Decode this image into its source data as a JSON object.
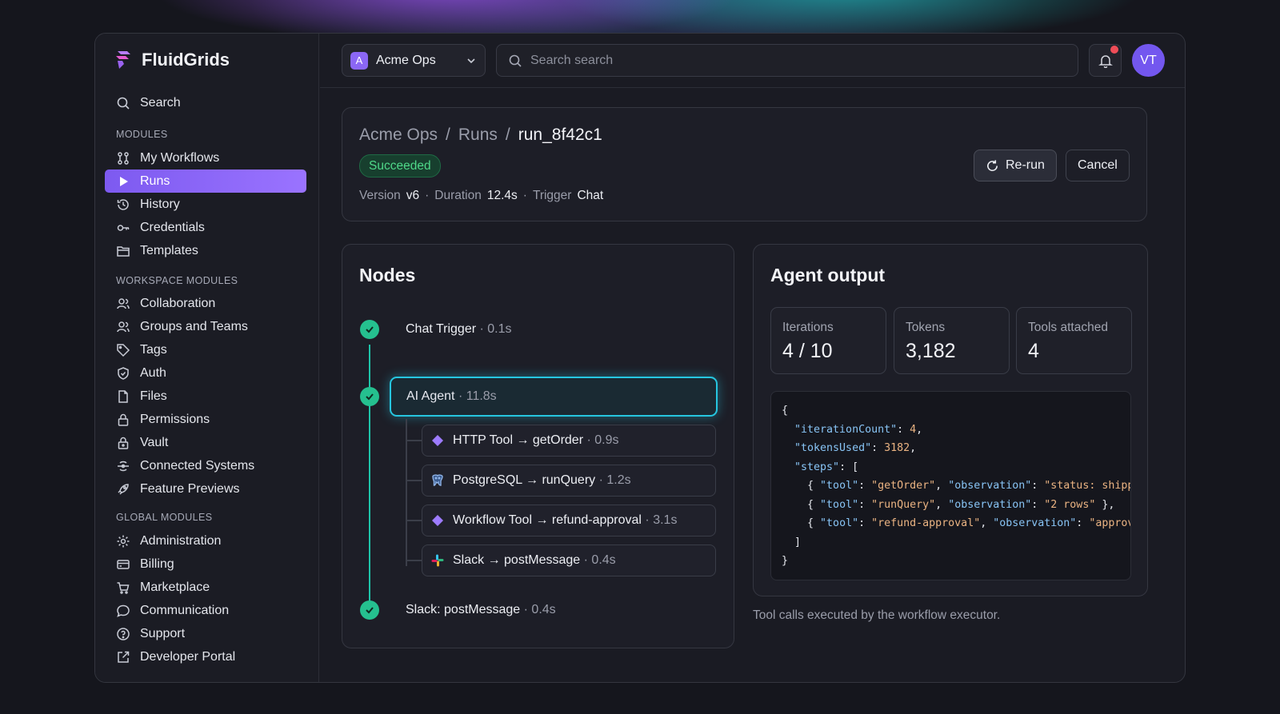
{
  "brand": {
    "name": "FluidGrids"
  },
  "sidebar": {
    "search_label": "Search",
    "sections": [
      {
        "label": "MODULES"
      },
      {
        "label": "WORKSPACE MODULES"
      },
      {
        "label": "GLOBAL MODULES"
      }
    ],
    "modules": [
      "My Workflows",
      "Runs",
      "History",
      "Credentials",
      "Templates"
    ],
    "active_item": "Runs",
    "workspace_modules": [
      "Collaboration",
      "Groups and Teams",
      "Tags",
      "Auth",
      "Files",
      "Permissions",
      "Vault",
      "Connected Systems",
      "Feature Previews"
    ],
    "global_modules": [
      "Administration",
      "Billing",
      "Marketplace",
      "Communication",
      "Support",
      "Developer Portal"
    ]
  },
  "topbar": {
    "workspace_badge": "A",
    "workspace_name": "Acme Ops",
    "search_placeholder": "Search search",
    "avatar_initials": "VT",
    "notification_dot_color": "#ef4d58"
  },
  "run": {
    "breadcrumb": [
      "Acme Ops",
      "Runs",
      "run_8f42c1"
    ],
    "breadcrumb_sep": "/",
    "status": "Succeeded",
    "version_label": "Version",
    "version": "v6",
    "duration_label": "Duration",
    "duration": "12.4s",
    "trigger_label": "Trigger",
    "trigger": "Chat",
    "rerun_label": "Re-run",
    "cancel_label": "Cancel"
  },
  "nodes": {
    "title": "Nodes",
    "items": [
      {
        "name": "Chat Trigger",
        "duration": "· 0.1s"
      },
      {
        "name": "AI Agent",
        "duration": "· 11.8s"
      },
      {
        "name": "Slack: postMessage",
        "duration": "· 0.4s"
      }
    ],
    "tools": [
      {
        "name": "HTTP Tool → getOrder",
        "duration": "· 0.9s",
        "icon": "diamond-icon"
      },
      {
        "name": "PostgreSQL → runQuery",
        "duration": "· 1.2s",
        "icon": "postgres-icon"
      },
      {
        "name": "Workflow Tool → refund-approval",
        "duration": "· 3.1s",
        "icon": "diamond-icon"
      },
      {
        "name": "Slack → postMessage",
        "duration": "· 0.4s",
        "icon": "slack-icon"
      }
    ]
  },
  "agent_output": {
    "title": "Agent output",
    "stats": [
      {
        "label": "Iterations",
        "value": "4 / 10"
      },
      {
        "label": "Tokens",
        "value": "3,182"
      },
      {
        "label": "Tools attached",
        "value": "4"
      }
    ],
    "code_lines": [
      "{",
      "  \"iterationCount\": 4,",
      "  \"tokensUsed\": 3182,",
      "  \"steps\": [",
      "    { \"tool\": \"getOrder\", \"observation\": \"status: shipped",
      "    { \"tool\": \"runQuery\", \"observation\": \"2 rows\" },",
      "    { \"tool\": \"refund-approval\", \"observation\": \"approved",
      "  ]",
      "}"
    ],
    "caption": "Tool calls executed by the workflow executor."
  },
  "colors": {
    "accent": "#8b67f5",
    "success": "#25c08f",
    "agent_highlight": "#26c6e0"
  }
}
